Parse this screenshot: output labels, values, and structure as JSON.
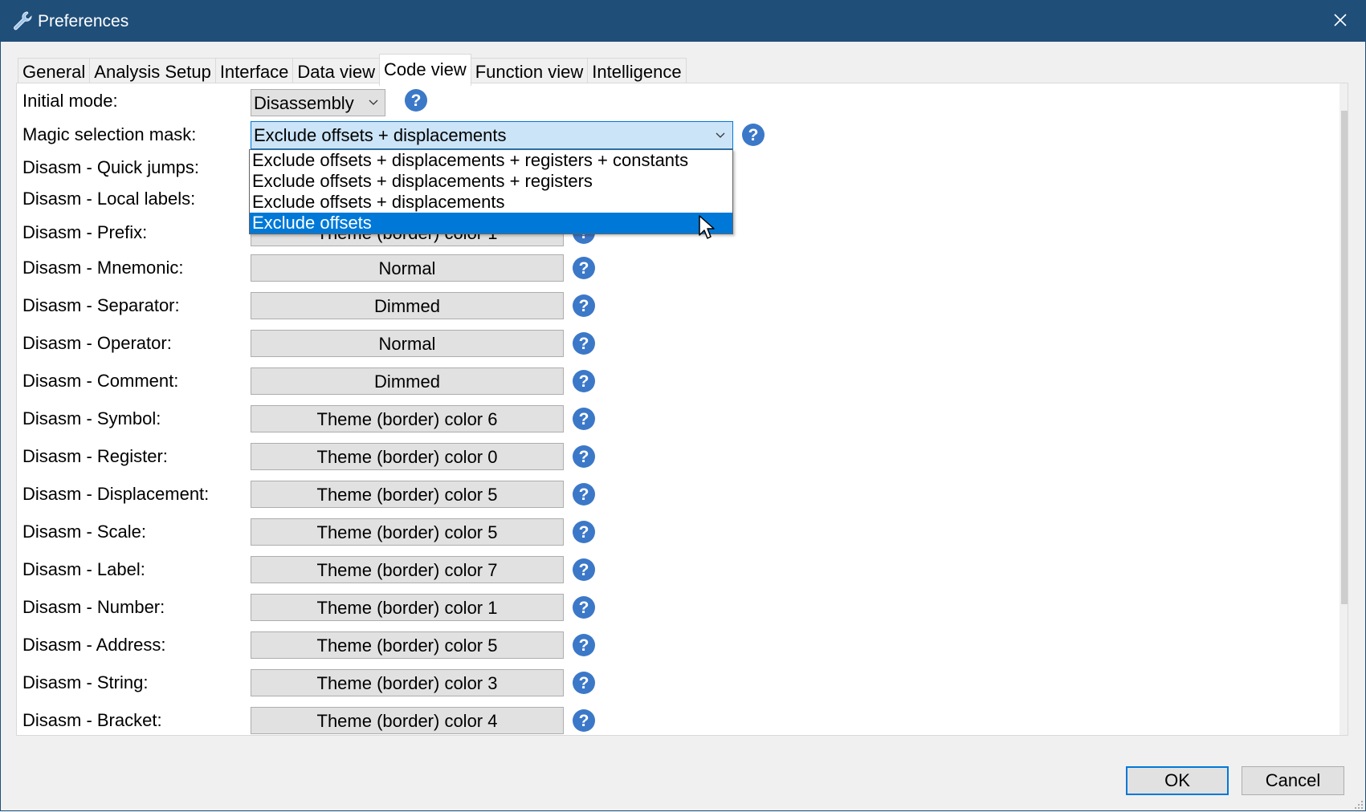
{
  "window": {
    "title": "Preferences",
    "app_icon": "wrench-icon",
    "close_icon": "close-icon"
  },
  "tabs": [
    {
      "label": "General"
    },
    {
      "label": "Analysis Setup"
    },
    {
      "label": "Interface"
    },
    {
      "label": "Data view"
    },
    {
      "label": "Code view",
      "active": true
    },
    {
      "label": "Function view"
    },
    {
      "label": "Intelligence"
    }
  ],
  "settings": {
    "initial_mode": {
      "label": "Initial mode:",
      "value": "Disassembly"
    },
    "magic_mask": {
      "label": "Magic selection mask:",
      "value": "Exclude offsets + displacements",
      "options": [
        "Exclude offsets + displacements + registers + constants",
        "Exclude offsets + displacements + registers",
        "Exclude offsets + displacements",
        "Exclude offsets"
      ],
      "highlighted_option": "Exclude offsets"
    },
    "quick_jumps": {
      "label": "Disasm - Quick jumps:"
    },
    "local_labels": {
      "label": "Disasm - Local labels:"
    },
    "prefix": {
      "label": "Disasm - Prefix:",
      "value": "Theme (border) color 1"
    },
    "rows": [
      {
        "label": "Disasm - Mnemonic:",
        "value": "Normal"
      },
      {
        "label": "Disasm - Separator:",
        "value": "Dimmed"
      },
      {
        "label": "Disasm - Operator:",
        "value": "Normal"
      },
      {
        "label": "Disasm - Comment:",
        "value": "Dimmed"
      },
      {
        "label": "Disasm - Symbol:",
        "value": "Theme (border) color 6"
      },
      {
        "label": "Disasm - Register:",
        "value": "Theme (border) color 0"
      },
      {
        "label": "Disasm - Displacement:",
        "value": "Theme (border) color 5"
      },
      {
        "label": "Disasm - Scale:",
        "value": "Theme (border) color 5"
      },
      {
        "label": "Disasm - Label:",
        "value": "Theme (border) color 7"
      },
      {
        "label": "Disasm - Number:",
        "value": "Theme (border) color 1"
      },
      {
        "label": "Disasm - Address:",
        "value": "Theme (border) color 5"
      },
      {
        "label": "Disasm - String:",
        "value": "Theme (border) color 3"
      },
      {
        "label": "Disasm - Bracket:",
        "value": "Theme (border) color 4"
      }
    ]
  },
  "footer": {
    "ok_label": "OK",
    "cancel_label": "Cancel"
  },
  "colors": {
    "titlebar": "#1f4e79",
    "accent": "#0078d7",
    "help_icon": "#3c78c8"
  },
  "icons": {
    "help": "help-icon",
    "dropdown": "chevron-down-icon",
    "cursor": "mouse-pointer-icon"
  }
}
